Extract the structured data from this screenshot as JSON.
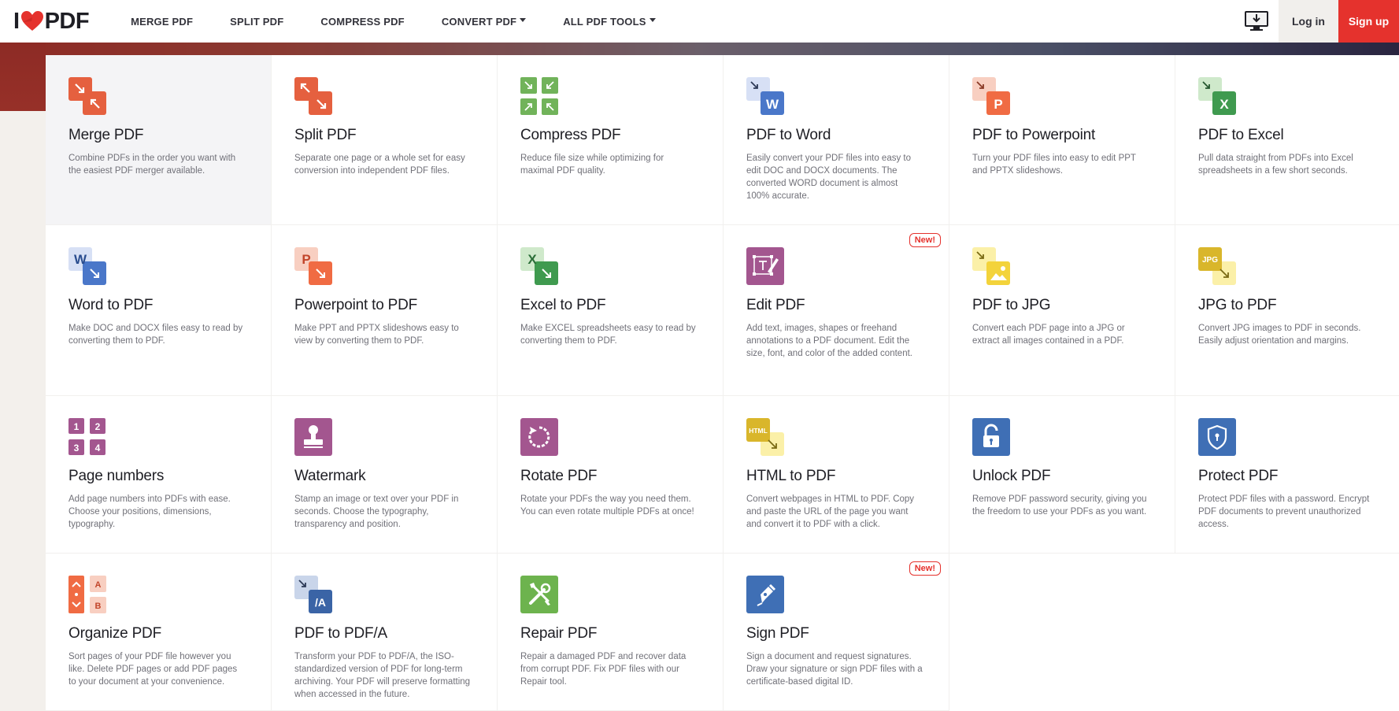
{
  "brand": {
    "logo_left": "I",
    "logo_right": "PDF",
    "heart_color": "#e5322d"
  },
  "nav": {
    "items": [
      {
        "label": "MERGE PDF",
        "dropdown": false
      },
      {
        "label": "SPLIT PDF",
        "dropdown": false
      },
      {
        "label": "COMPRESS PDF",
        "dropdown": false
      },
      {
        "label": "CONVERT PDF",
        "dropdown": true
      },
      {
        "label": "ALL PDF TOOLS",
        "dropdown": true
      }
    ],
    "desktop_icon": "desktop-download-icon",
    "login": "Log in",
    "signup": "Sign up"
  },
  "colors": {
    "accent": "#e5322d",
    "header_bg": "#ffffff",
    "card_bg": "#ffffff"
  },
  "tools": [
    {
      "title": "Merge PDF",
      "desc": "Combine PDFs in the order you want with the easiest PDF merger available.",
      "icon": "merge-icon",
      "selected": true
    },
    {
      "title": "Split PDF",
      "desc": "Separate one page or a whole set for easy conversion into independent PDF files.",
      "icon": "split-icon"
    },
    {
      "title": "Compress PDF",
      "desc": "Reduce file size while optimizing for maximal PDF quality.",
      "icon": "compress-icon"
    },
    {
      "title": "PDF to Word",
      "desc": "Easily convert your PDF files into easy to edit DOC and DOCX documents. The converted WORD document is almost 100% accurate.",
      "icon": "pdf-to-word-icon"
    },
    {
      "title": "PDF to Powerpoint",
      "desc": "Turn your PDF files into easy to edit PPT and PPTX slideshows.",
      "icon": "pdf-to-powerpoint-icon"
    },
    {
      "title": "PDF to Excel",
      "desc": "Pull data straight from PDFs into Excel spreadsheets in a few short seconds.",
      "icon": "pdf-to-excel-icon"
    },
    {
      "title": "Word to PDF",
      "desc": "Make DOC and DOCX files easy to read by converting them to PDF.",
      "icon": "word-to-pdf-icon"
    },
    {
      "title": "Powerpoint to PDF",
      "desc": "Make PPT and PPTX slideshows easy to view by converting them to PDF.",
      "icon": "powerpoint-to-pdf-icon"
    },
    {
      "title": "Excel to PDF",
      "desc": "Make EXCEL spreadsheets easy to read by converting them to PDF.",
      "icon": "excel-to-pdf-icon"
    },
    {
      "title": "Edit PDF",
      "desc": "Add text, images, shapes or freehand annotations to a PDF document. Edit the size, font, and color of the added content.",
      "icon": "edit-pdf-icon",
      "badge": "New!"
    },
    {
      "title": "PDF to JPG",
      "desc": "Convert each PDF page into a JPG or extract all images contained in a PDF.",
      "icon": "pdf-to-jpg-icon"
    },
    {
      "title": "JPG to PDF",
      "desc": "Convert JPG images to PDF in seconds. Easily adjust orientation and margins.",
      "icon": "jpg-to-pdf-icon"
    },
    {
      "title": "Page numbers",
      "desc": "Add page numbers into PDFs with ease. Choose your positions, dimensions, typography.",
      "icon": "page-numbers-icon"
    },
    {
      "title": "Watermark",
      "desc": "Stamp an image or text over your PDF in seconds. Choose the typography, transparency and position.",
      "icon": "watermark-icon"
    },
    {
      "title": "Rotate PDF",
      "desc": "Rotate your PDFs the way you need them. You can even rotate multiple PDFs at once!",
      "icon": "rotate-icon"
    },
    {
      "title": "HTML to PDF",
      "desc": "Convert webpages in HTML to PDF. Copy and paste the URL of the page you want and convert it to PDF with a click.",
      "icon": "html-to-pdf-icon"
    },
    {
      "title": "Unlock PDF",
      "desc": "Remove PDF password security, giving you the freedom to use your PDFs as you want.",
      "icon": "unlock-icon"
    },
    {
      "title": "Protect PDF",
      "desc": "Protect PDF files with a password. Encrypt PDF documents to prevent unauthorized access.",
      "icon": "protect-icon"
    },
    {
      "title": "Organize PDF",
      "desc": "Sort pages of your PDF file however you like. Delete PDF pages or add PDF pages to your document at your convenience.",
      "icon": "organize-icon"
    },
    {
      "title": "PDF to PDF/A",
      "desc": "Transform your PDF to PDF/A, the ISO-standardized version of PDF for long-term archiving. Your PDF will preserve formatting when accessed in the future.",
      "icon": "pdf-to-pdfa-icon"
    },
    {
      "title": "Repair PDF",
      "desc": "Repair a damaged PDF and recover data from corrupt PDF. Fix PDF files with our Repair tool.",
      "icon": "repair-icon"
    },
    {
      "title": "Sign PDF",
      "desc": "Sign a document and request signatures. Draw your signature or sign PDF files with a certificate-based digital ID.",
      "icon": "sign-icon",
      "badge": "New!"
    }
  ],
  "icon_text": {
    "word": "W",
    "ppt": "P",
    "excel": "X",
    "jpg": "JPG",
    "html": "HTML",
    "pdfa": "/A",
    "n1": "1",
    "n2": "2",
    "n3": "3",
    "n4": "4",
    "a": "A",
    "b": "B"
  }
}
